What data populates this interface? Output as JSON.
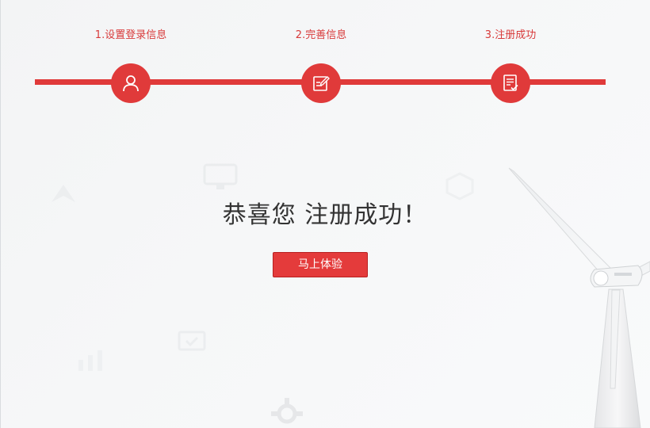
{
  "steps": [
    {
      "label": "1.设置登录信息",
      "icon": "user-icon"
    },
    {
      "label": "2.完善信息",
      "icon": "edit-form-icon"
    },
    {
      "label": "3.注册成功",
      "icon": "document-check-icon"
    }
  ],
  "main": {
    "title": "恭喜您 注册成功！",
    "cta_label": "马上体验"
  },
  "colors": {
    "accent": "#e03a3a",
    "title_text": "#333333",
    "background": "#f5f6f7"
  }
}
